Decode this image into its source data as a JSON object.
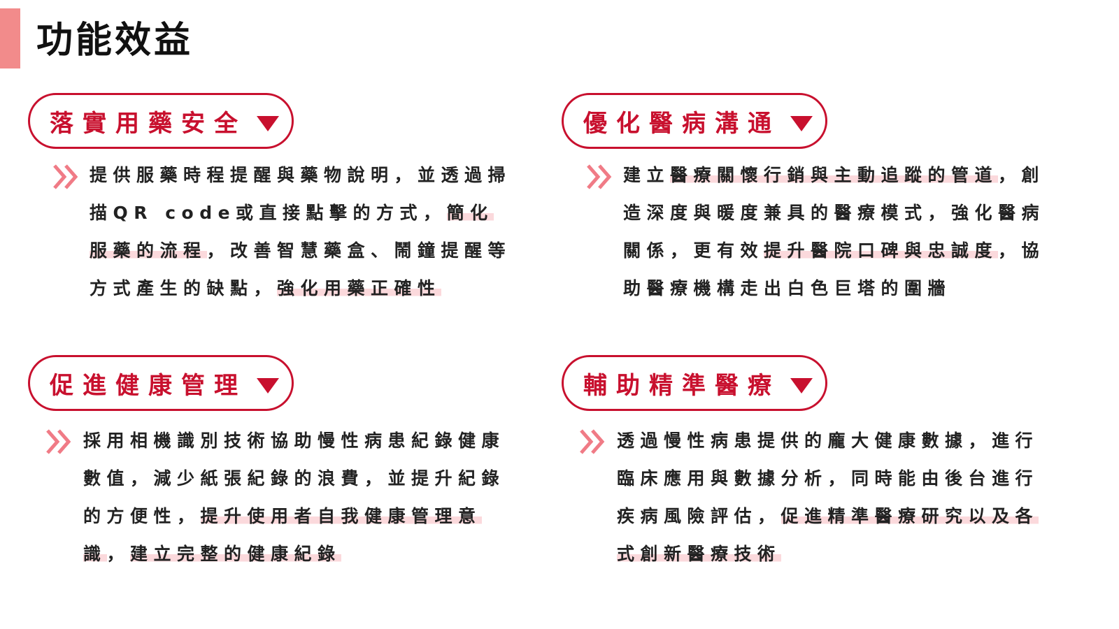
{
  "page": {
    "title": "功能效益"
  },
  "sections": [
    {
      "heading": "落實用藥安全",
      "text": [
        {
          "t": "提供服藥時程提醒與藥物說明，並透過掃描QR code或直接點擊的方式，",
          "hl": false
        },
        {
          "t": "簡化服藥的流程",
          "hl": true
        },
        {
          "t": "，改善智慧藥盒、鬧鐘提醒等方式產生的缺點，",
          "hl": false
        },
        {
          "t": "強化用藥正確性",
          "hl": true
        }
      ]
    },
    {
      "heading": "優化醫病溝通",
      "text": [
        {
          "t": "建立",
          "hl": false
        },
        {
          "t": "醫療關懷行銷與主動追蹤的管道",
          "hl": true
        },
        {
          "t": "，創造深度與暖度兼具的醫療模式，強化醫病關係，更有效",
          "hl": false
        },
        {
          "t": "提升醫院口碑與忠誠度",
          "hl": true
        },
        {
          "t": "，協助醫療機構走出白色巨塔的圍牆",
          "hl": false
        }
      ]
    },
    {
      "heading": "促進健康管理",
      "text": [
        {
          "t": "採用相機識別技術協助慢性病患紀錄健康數值，減少紙張紀錄的浪費，並提升紀錄的方便性，",
          "hl": false
        },
        {
          "t": "提升使用者自我健康管理意識",
          "hl": true
        },
        {
          "t": "，",
          "hl": false
        },
        {
          "t": "建立完整的健康紀錄",
          "hl": true
        }
      ]
    },
    {
      "heading": "輔助精準醫療",
      "text": [
        {
          "t": "透過慢性病患提供的龐大健康數據，進行臨床應用與數據分析，同時能由後台進行疾病風險評估，",
          "hl": false
        },
        {
          "t": "促進精準醫療研究以及各式創新醫療技術",
          "hl": true
        }
      ]
    }
  ],
  "colors": {
    "accent": "#c8102e",
    "bar": "#f28b8b",
    "chevron": "#f07b86",
    "highlight": "#fbd9dc"
  },
  "icons": {
    "heading_marker": "caret-down-icon",
    "bullet": "double-chevron-right-icon"
  }
}
